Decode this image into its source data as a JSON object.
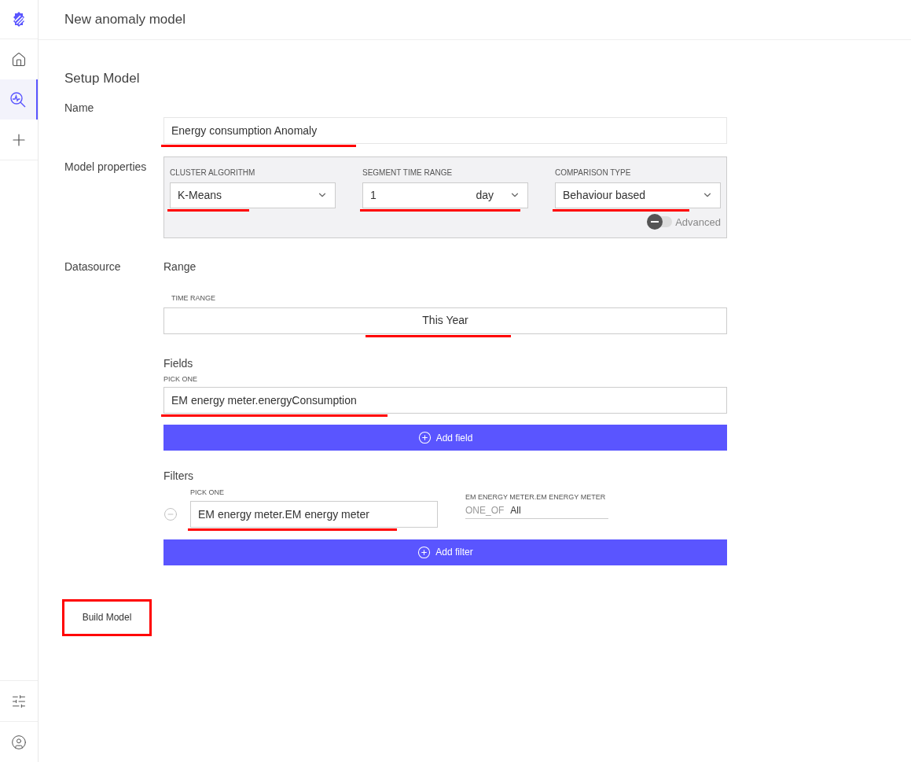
{
  "sidebar": {
    "items": [
      {
        "kind": "home",
        "selected": false
      },
      {
        "kind": "search",
        "selected": true
      },
      {
        "kind": "add",
        "selected": false
      }
    ],
    "bottom_items": [
      {
        "kind": "sliders"
      },
      {
        "kind": "user"
      }
    ]
  },
  "header": {
    "title": "New anomaly model"
  },
  "setup": {
    "title": "Setup Model",
    "name": {
      "label": "Name",
      "value": "Energy consumption Anomaly",
      "highlighted": true
    },
    "model_properties": {
      "label": "Model properties",
      "selects": [
        {
          "label": "CLUSTER ALGORITHM",
          "value": "K-Means",
          "highlighted": true
        },
        {
          "label": "SEGMENT TIME RANGE",
          "value": "1",
          "unit": "day",
          "highlighted": true
        },
        {
          "label": "COMPARISON TYPE",
          "value": "Behaviour based",
          "highlighted": true
        }
      ],
      "advanced": {
        "label": "Advanced",
        "on": false
      }
    },
    "datasource": {
      "label": "Datasource",
      "range_title": "Range",
      "time_range": {
        "label": "TIME RANGE",
        "value": "This Year",
        "highlighted": true
      },
      "fields": {
        "title": "Fields",
        "pick_label": "PICK ONE",
        "value": "EM energy meter.energyConsumption",
        "highlighted": true,
        "add_button": "Add field"
      },
      "filters": {
        "title": "Filters",
        "pick_label": "PICK ONE",
        "value": "EM energy meter.EM energy meter",
        "highlighted": true,
        "condition_label": "EM ENERGY METER.EM ENERGY METER",
        "operator": "ONE_OF",
        "condition_value": "All",
        "add_button": "Add filter"
      }
    },
    "build_button": {
      "label": "Build Model",
      "highlighted": true
    }
  }
}
